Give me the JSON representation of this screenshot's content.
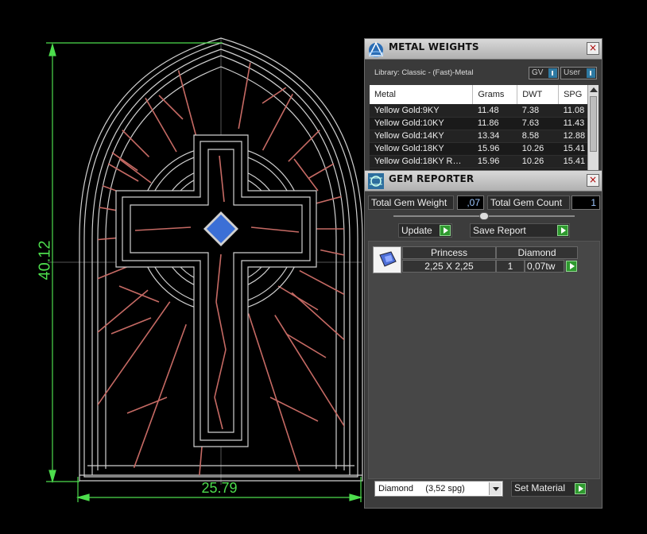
{
  "drawing": {
    "height_dimension": "40.12",
    "width_dimension": "25.79",
    "colors": {
      "dimension": "#4ddd4d",
      "outline": "#d0d0d0",
      "lead": "#c66a64",
      "gem": "#3b6fd6"
    }
  },
  "metal_weights": {
    "title": "METAL WEIGHTS",
    "close_label": "×",
    "library_label": "Library: Classic - (Fast)-Metal",
    "gv_label": "GV",
    "user_label": "User",
    "columns": [
      "Metal",
      "Grams",
      "DWT",
      "SPG"
    ],
    "rows": [
      [
        "Yellow Gold:9KY",
        "11.48",
        "7.38",
        "11.08"
      ],
      [
        "Yellow Gold:10KY",
        "11.86",
        "7.63",
        "11.43"
      ],
      [
        "Yellow Gold:14KY",
        "13.34",
        "8.58",
        "12.88"
      ],
      [
        "Yellow Gold:18KY",
        "15.96",
        "10.26",
        "15.41"
      ],
      [
        "Yellow Gold:18KY R…",
        "15.96",
        "10.26",
        "15.41"
      ]
    ]
  },
  "gem_reporter": {
    "title": "GEM REPORTER",
    "close_label": "×",
    "total_weight_label": "Total Gem Weight",
    "total_weight_value": ",07",
    "total_count_label": "Total Gem Count",
    "total_count_value": "1",
    "update_label": "Update",
    "save_report_label": "Save Report",
    "gems": [
      {
        "shape": "Princess",
        "size": "2,25 X 2,25",
        "material": "Diamond",
        "count": "1",
        "weight": "0,07tw"
      }
    ],
    "material_select": "Diamond     (3,52 spg)",
    "set_material_label": "Set Material"
  }
}
